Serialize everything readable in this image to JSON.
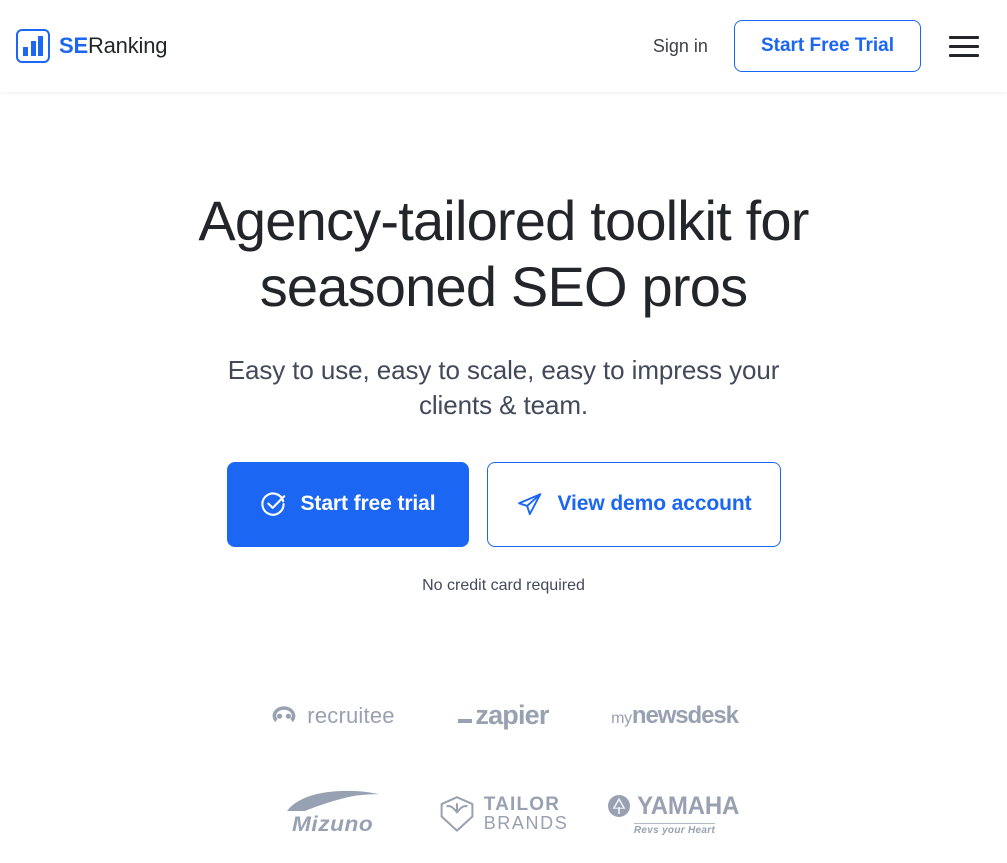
{
  "header": {
    "brand": {
      "se": "SE",
      "ranking": "Ranking",
      "logo_icon": "bar-chart-icon"
    },
    "signin_label": "Sign in",
    "trial_label": "Start Free Trial",
    "menu_icon": "hamburger-menu-icon"
  },
  "hero": {
    "title_line1": "Agency-tailored toolkit for",
    "title_line2": "seasoned SEO pros",
    "subtitle": "Easy to use, easy to scale, easy to impress your clients & team.",
    "primary_cta": {
      "label": "Start free trial",
      "icon": "check-circle-icon"
    },
    "secondary_cta": {
      "label": "View demo account",
      "icon": "paper-plane-icon"
    },
    "note": "No credit card required"
  },
  "logos": {
    "row1": [
      {
        "name": "recruitee",
        "label": "recruitee",
        "icon": "recruitee-mark-icon"
      },
      {
        "name": "zapier",
        "label": "zapier",
        "icon": "zapier-dash-icon"
      },
      {
        "name": "mynewsdesk",
        "label_small": "my",
        "label_bold": "newsdesk"
      }
    ],
    "row2": [
      {
        "name": "mizuno",
        "label": "Mizuno",
        "icon": "mizuno-swoosh-icon"
      },
      {
        "name": "tailor-brands",
        "label_line1": "TAILOR",
        "label_line2": "BRANDS",
        "icon": "tailor-brands-shield-icon"
      },
      {
        "name": "yamaha",
        "label": "YAMAHA",
        "tagline": "Revs your Heart",
        "icon": "yamaha-tuning-forks-icon"
      }
    ]
  },
  "colors": {
    "brand_blue": "#1b66f2",
    "text_dark": "#22252a",
    "text_muted": "#41495a",
    "logo_gray": "#98a1b1"
  }
}
